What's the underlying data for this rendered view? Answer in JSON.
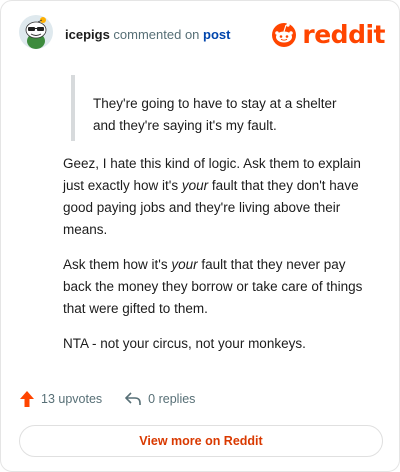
{
  "header": {
    "username": "icepigs",
    "commented_text": "commented on",
    "post_link": "post",
    "brand_word": "reddit",
    "brand_color": "#ff4500"
  },
  "comment": {
    "quote_lines": [
      "They're going to have to stay at a shelter",
      "and they're saying it's my fault."
    ],
    "paragraphs": [
      {
        "before": "Geez, I hate this kind of logic. Ask them to explain just exactly how it's ",
        "emph": "your",
        "after": " fault that they don't have good paying jobs and they're living above their means."
      },
      {
        "before": "Ask them how it's ",
        "emph": "your",
        "after": " fault that they never pay back the money they borrow or take care of things that were gifted to them."
      },
      {
        "before": "NTA - not your circus, not your monkeys.",
        "emph": "",
        "after": ""
      }
    ]
  },
  "footer": {
    "upvotes": "13 upvotes",
    "replies": "0 replies",
    "upvote_icon": "upvote-arrow-icon",
    "reply_icon": "reply-arrow-icon",
    "upvote_color": "#ff4500"
  },
  "cta": {
    "label": "View more on Reddit"
  }
}
